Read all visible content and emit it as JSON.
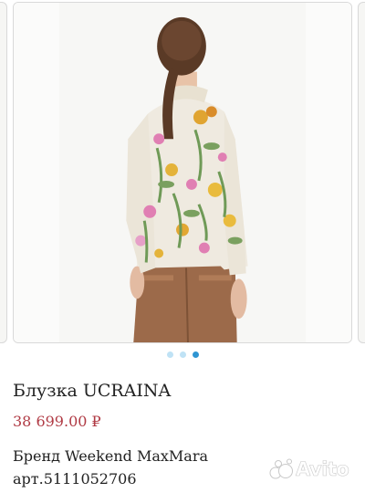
{
  "gallery": {
    "image_alt": "Блузка UCRAINA",
    "dots": 3,
    "active_dot": 2
  },
  "product": {
    "title": "Блузка UCRAINA",
    "price": "38 699.00 ₽",
    "brand": "Бренд Weekend MaxMara",
    "sku": "арт.5111052706"
  },
  "watermark": {
    "text": "Avito",
    "icon": "avito-logo-icon"
  },
  "colors": {
    "price": "#b03a44",
    "dot_active": "#2f95d2",
    "dot_inactive": "#bfe2f5"
  }
}
